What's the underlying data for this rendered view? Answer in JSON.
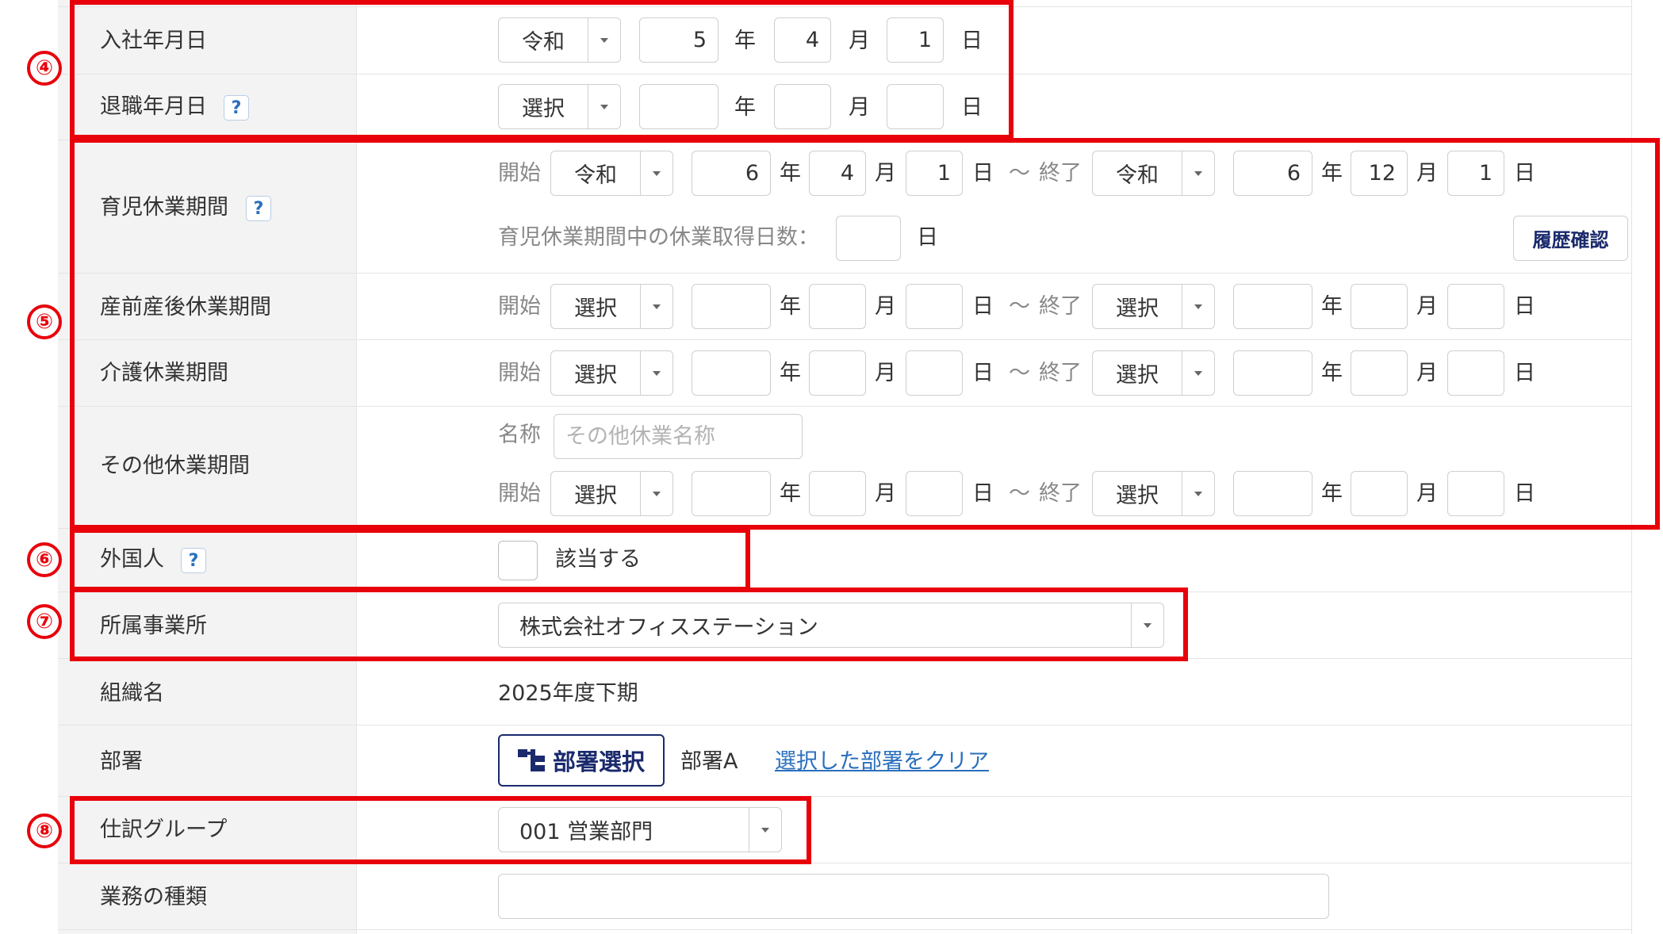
{
  "rows": {
    "hire_date": {
      "label": "入社年月日",
      "era": "令和",
      "year": "5",
      "month": "4",
      "day": "1"
    },
    "retire_date": {
      "label": "退職年月日",
      "era": "選択",
      "year": "",
      "month": "",
      "day": ""
    },
    "childcare_leave": {
      "label": "育児休業期間",
      "start": {
        "era": "令和",
        "year": "6",
        "month": "4",
        "day": "1"
      },
      "end": {
        "era": "令和",
        "year": "6",
        "month": "12",
        "day": "1"
      },
      "days_label": "育児休業期間中の休業取得日数：",
      "days_value": "",
      "history_button": "履歴確認"
    },
    "maternity_leave": {
      "label": "産前産後休業期間",
      "start": {
        "era": "選択",
        "year": "",
        "month": "",
        "day": ""
      },
      "end": {
        "era": "選択",
        "year": "",
        "month": "",
        "day": ""
      }
    },
    "care_leave": {
      "label": "介護休業期間",
      "start": {
        "era": "選択",
        "year": "",
        "month": "",
        "day": ""
      },
      "end": {
        "era": "選択",
        "year": "",
        "month": "",
        "day": ""
      }
    },
    "other_leave": {
      "label": "その他休業期間",
      "name_label": "名称",
      "name_placeholder": "その他休業名称",
      "start": {
        "era": "選択",
        "year": "",
        "month": "",
        "day": ""
      },
      "end": {
        "era": "選択",
        "year": "",
        "month": "",
        "day": ""
      }
    },
    "foreigner": {
      "label": "外国人",
      "checkbox_label": "該当する"
    },
    "office": {
      "label": "所属事業所",
      "value": "株式会社オフィスステーション"
    },
    "organization": {
      "label": "組織名",
      "value": "2025年度下期"
    },
    "department": {
      "label": "部署",
      "button": "部署選択",
      "value": "部署A",
      "clear_link": "選択した部署をクリア"
    },
    "journal_group": {
      "label": "仕訳グループ",
      "value": "001 営業部門"
    },
    "job_type": {
      "label": "業務の種類",
      "value": ""
    }
  },
  "units": {
    "year": "年",
    "month": "月",
    "day": "日",
    "start": "開始",
    "end": "終了",
    "tilde": "～"
  },
  "help_icon": "?",
  "annotations": [
    "④",
    "⑤",
    "⑥",
    "⑦",
    "⑧"
  ],
  "colors": {
    "annotation_red": "#e8000b",
    "label_bg": "#f3f3f3",
    "link_blue": "#2a6fbd",
    "button_navy": "#1a2a6c"
  }
}
